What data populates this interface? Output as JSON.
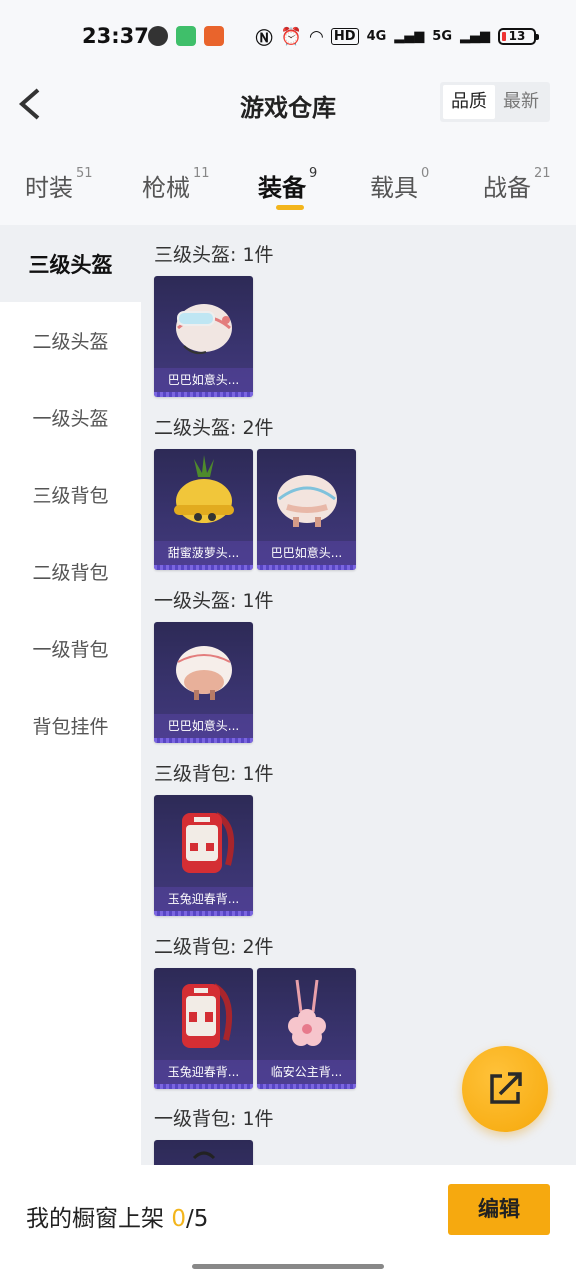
{
  "status_bar": {
    "time": "23:37",
    "battery": "13",
    "signal_labels": [
      "HD",
      "4G",
      "5G"
    ]
  },
  "header": {
    "title": "游戏仓库",
    "sort_options": [
      "品质",
      "最新"
    ],
    "active_sort": "品质"
  },
  "tabs": [
    {
      "label": "时装",
      "count": "51"
    },
    {
      "label": "枪械",
      "count": "11"
    },
    {
      "label": "装备",
      "count": "9"
    },
    {
      "label": "载具",
      "count": "0"
    },
    {
      "label": "战备",
      "count": "21"
    }
  ],
  "active_tab": "装备",
  "sidebar": {
    "items": [
      "三级头盔",
      "二级头盔",
      "一级头盔",
      "三级背包",
      "二级背包",
      "一级背包",
      "背包挂件"
    ],
    "active": "三级头盔"
  },
  "sections": [
    {
      "title": "三级头盔: 1件",
      "items": [
        {
          "name": "巴巴如意头...",
          "icon": "helmet-icon"
        }
      ]
    },
    {
      "title": "二级头盔: 2件",
      "items": [
        {
          "name": "甜蜜菠萝头...",
          "icon": "pineapple-helmet-icon"
        },
        {
          "name": "巴巴如意头...",
          "icon": "helmet-icon"
        }
      ]
    },
    {
      "title": "一级头盔: 1件",
      "items": [
        {
          "name": "巴巴如意头...",
          "icon": "helmet-icon"
        }
      ]
    },
    {
      "title": "三级背包: 1件",
      "items": [
        {
          "name": "玉兔迎春背...",
          "icon": "backpack-icon"
        }
      ]
    },
    {
      "title": "二级背包: 2件",
      "items": [
        {
          "name": "玉兔迎春背...",
          "icon": "backpack-icon"
        },
        {
          "name": "临安公主背...",
          "icon": "flower-bag-icon"
        }
      ]
    },
    {
      "title": "一级背包: 1件",
      "items": [
        {
          "name": "",
          "icon": "backpack-icon"
        }
      ]
    }
  ],
  "bottom": {
    "label": "我的橱窗上架",
    "count": "0",
    "total": "/5",
    "edit_label": "编辑"
  },
  "colors": {
    "accent": "#f3b51c",
    "card_bg": "#3a3470",
    "edit_button": "#f6a90f"
  }
}
